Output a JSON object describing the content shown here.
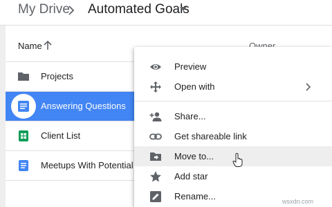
{
  "breadcrumb": {
    "root": "My Drive",
    "current": "Automated Goals"
  },
  "list_header": {
    "name": "Name",
    "owner": "Owner"
  },
  "files": [
    {
      "name": "Projects",
      "type": "folder"
    },
    {
      "name": "Answering Questions",
      "type": "doc",
      "selected": true
    },
    {
      "name": "Client List",
      "type": "sheet"
    },
    {
      "name": "Meetups With Potential Cl",
      "type": "doc"
    }
  ],
  "context_menu": {
    "items": [
      {
        "label": "Preview",
        "icon": "eye-icon"
      },
      {
        "label": "Open with",
        "icon": "open-with-icon",
        "submenu": true
      },
      {
        "label": "Share...",
        "icon": "person-add-icon"
      },
      {
        "label": "Get shareable link",
        "icon": "link-icon"
      },
      {
        "label": "Move to...",
        "icon": "move-folder-icon",
        "hover": true
      },
      {
        "label": "Add star",
        "icon": "star-icon"
      },
      {
        "label": "Rename...",
        "icon": "rename-icon"
      }
    ]
  },
  "colors": {
    "selected": "#4285f4",
    "doc": "#4285f4",
    "sheet": "#0f9d58",
    "icon": "#5f6368"
  },
  "watermark": "wsxdn.com"
}
